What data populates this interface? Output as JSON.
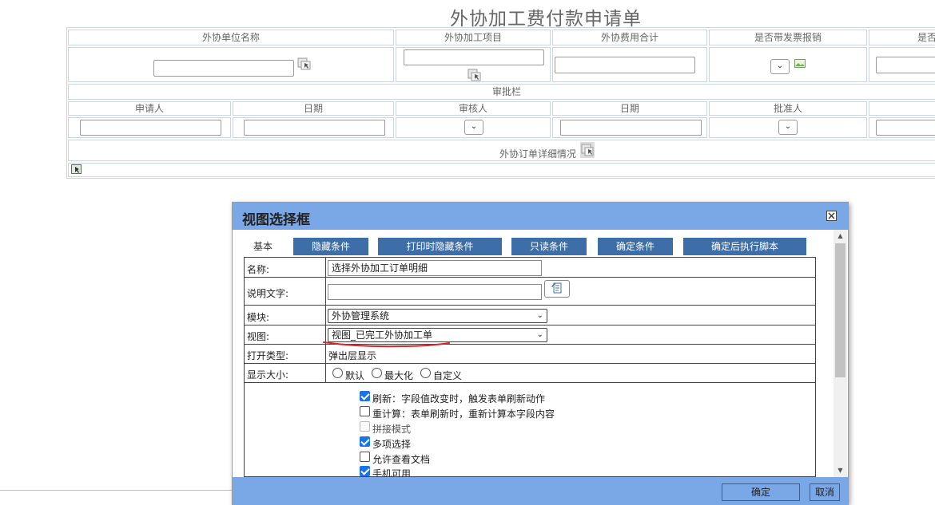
{
  "form": {
    "title": "外协加工费付款申请单",
    "headers": [
      "外协单位名称",
      "外协加工项目",
      "外协费用合计",
      "是否带发票报销",
      "是否"
    ],
    "approval_bar": "审批栏",
    "approval_headers": [
      "申请人",
      "日期",
      "审核人",
      "日期",
      "批准人"
    ],
    "detail_label": "外协订单详细情况"
  },
  "dialog": {
    "title": "视图选择框",
    "tabs": [
      "基本",
      "隐藏条件",
      "打印时隐藏条件",
      "只读条件",
      "确定条件",
      "确定后执行脚本"
    ],
    "rows": {
      "name_label": "名称:",
      "name_value": "选择外协加工订单明细",
      "desc_label": "说明文字:",
      "desc_value": "",
      "module_label": "模块:",
      "module_value": "外协管理系统",
      "view_label": "视图:",
      "view_value": "视图_已完工外协加工单",
      "open_label": "打开类型:",
      "open_value": "弹出层显示",
      "size_label": "显示大小:",
      "size_options": [
        "默认",
        "最大化",
        "自定义"
      ]
    },
    "options": [
      {
        "label": "刷新：字段值改变时，触发表单刷新动作",
        "checked": true,
        "disabled": false
      },
      {
        "label": "重计算：表单刷新时，重新计算本字段内容",
        "checked": false,
        "disabled": false
      },
      {
        "label": "拼接模式",
        "checked": false,
        "disabled": true
      },
      {
        "label": "多项选择",
        "checked": true,
        "disabled": false
      },
      {
        "label": "允许查看文档",
        "checked": false,
        "disabled": false
      },
      {
        "label": "手机可用",
        "checked": true,
        "disabled": false
      }
    ],
    "buttons": {
      "ok": "确定",
      "cancel": "取消"
    }
  },
  "colors": {
    "dialog_header": "#7aa7e6",
    "tab_bg": "#3d6ea8",
    "checkbox_checked": "#1a73e8",
    "annotation": "#d9252a"
  },
  "icons": [
    "picker-icon",
    "image-icon",
    "close-icon",
    "chevron-down-icon",
    "reload-icon"
  ]
}
